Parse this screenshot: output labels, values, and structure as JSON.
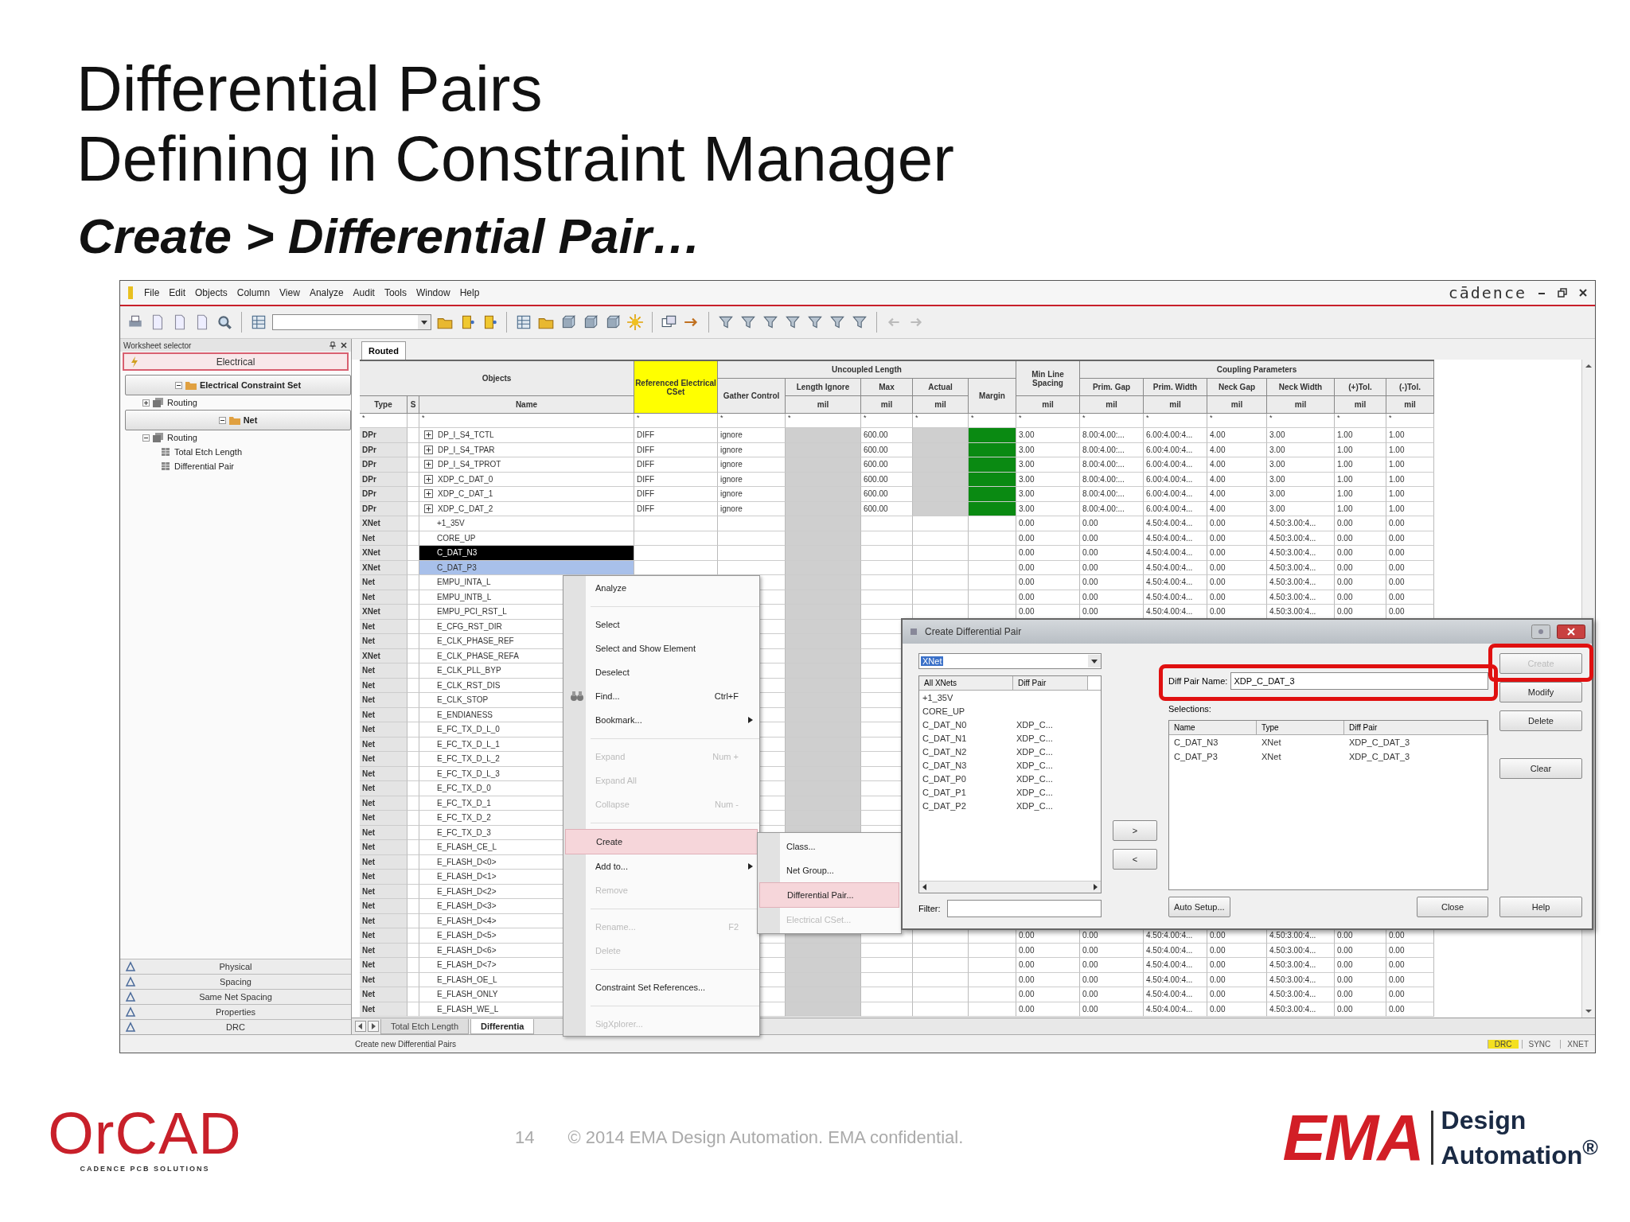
{
  "slide": {
    "title_lines": [
      "Differential Pairs",
      "Defining in Constraint Manager"
    ],
    "subtitle": "Create > Differential Pair…"
  },
  "app": {
    "menu": [
      "File",
      "Edit",
      "Objects",
      "Column",
      "View",
      "Analyze",
      "Audit",
      "Tools",
      "Window",
      "Help"
    ],
    "brand": "cādence",
    "worksheet_selector": {
      "title": "Worksheet selector",
      "top_tabs": [
        {
          "label": "Electrical",
          "selected": true
        }
      ],
      "tree": [
        {
          "label": "Electrical Constraint Set",
          "expanded": true,
          "children": [
            {
              "label": "Routing",
              "expanded": false
            }
          ]
        },
        {
          "label": "Net",
          "expanded": true,
          "children": [
            {
              "label": "Routing",
              "expanded": true,
              "children": [
                {
                  "label": "Total Etch Length"
                },
                {
                  "label": "Differential Pair"
                }
              ]
            }
          ]
        }
      ],
      "bottom_tabs": [
        {
          "label": "Physical",
          "selected": false
        },
        {
          "label": "Spacing",
          "selected": false
        },
        {
          "label": "Same Net Spacing",
          "selected": false
        },
        {
          "label": "Properties",
          "selected": false
        },
        {
          "label": "DRC",
          "selected": false
        }
      ]
    },
    "sheet_tab": "Routed",
    "table": {
      "header": {
        "objects": "Objects",
        "type": "Type",
        "s": "S",
        "name": "Name",
        "ref": "Referenced Electrical CSet",
        "ref_highlighted": true,
        "gather": "Gather Control",
        "uncoupled": "Uncoupled Length",
        "length_ignore": "Length Ignore",
        "max": "Max",
        "actual": "Actual",
        "margin": "Margin",
        "min_line": "Min Line Spacing",
        "coupling": "Coupling Parameters",
        "coupling_cols": [
          "Prim. Gap",
          "Prim. Width",
          "Neck Gap",
          "Neck Width",
          "(+)Tol.",
          "(-)Tol."
        ],
        "units": [
          "mil",
          "mil",
          "mil",
          "mil",
          "mil",
          "mil",
          "mil",
          "mil",
          "mil",
          "mil"
        ]
      },
      "filters": [
        "*",
        "*",
        "*",
        "*",
        "*",
        "*",
        "*",
        "*",
        "*",
        "*",
        "*",
        "*",
        "*",
        "*",
        "*"
      ],
      "rows": [
        {
          "type": "DPr",
          "name": "DP_I_S4_TCTL",
          "expanded": false,
          "selected": false,
          "ref": "DIFF",
          "gather": "ignore",
          "max": "600.00",
          "margin_ok": true,
          "spacing": [
            "3.00",
            "8.00:4.00:...",
            "6.00:4.00:4...",
            "4.00",
            "3.00",
            "1.00",
            "1.00"
          ]
        },
        {
          "type": "DPr",
          "name": "DP_I_S4_TPAR",
          "expanded": false,
          "selected": false,
          "ref": "DIFF",
          "gather": "ignore",
          "max": "600.00",
          "margin_ok": true,
          "spacing": [
            "3.00",
            "8.00:4.00:...",
            "6.00:4.00:4...",
            "4.00",
            "3.00",
            "1.00",
            "1.00"
          ]
        },
        {
          "type": "DPr",
          "name": "DP_I_S4_TPROT",
          "expanded": false,
          "selected": false,
          "ref": "DIFF",
          "gather": "ignore",
          "max": "600.00",
          "margin_ok": true,
          "spacing": [
            "3.00",
            "8.00:4.00:...",
            "6.00:4.00:4...",
            "4.00",
            "3.00",
            "1.00",
            "1.00"
          ]
        },
        {
          "type": "DPr",
          "name": "XDP_C_DAT_0",
          "expanded": false,
          "selected": false,
          "ref": "DIFF",
          "gather": "ignore",
          "max": "600.00",
          "margin_ok": true,
          "spacing": [
            "3.00",
            "8.00:4.00:...",
            "6.00:4.00:4...",
            "4.00",
            "3.00",
            "1.00",
            "1.00"
          ]
        },
        {
          "type": "DPr",
          "name": "XDP_C_DAT_1",
          "expanded": false,
          "selected": false,
          "ref": "DIFF",
          "gather": "ignore",
          "max": "600.00",
          "margin_ok": true,
          "spacing": [
            "3.00",
            "8.00:4.00:...",
            "6.00:4.00:4...",
            "4.00",
            "3.00",
            "1.00",
            "1.00"
          ]
        },
        {
          "type": "DPr",
          "name": "XDP_C_DAT_2",
          "expanded": false,
          "selected": false,
          "ref": "DIFF",
          "gather": "ignore",
          "max": "600.00",
          "margin_ok": true,
          "spacing": [
            "3.00",
            "8.00:4.00:...",
            "6.00:4.00:4...",
            "4.00",
            "3.00",
            "1.00",
            "1.00"
          ]
        },
        {
          "type": "XNet",
          "name": "+1_35V",
          "selected": false,
          "margin_ok": false,
          "spacing": [
            "0.00",
            "0.00",
            "4.50:4.00:4...",
            "0.00",
            "4.50:3.00:4...",
            "0.00",
            "0.00"
          ]
        },
        {
          "type": "Net",
          "name": "CORE_UP",
          "selected": false,
          "margin_ok": false,
          "spacing": [
            "0.00",
            "0.00",
            "4.50:4.00:4...",
            "0.00",
            "4.50:3.00:4...",
            "0.00",
            "0.00"
          ]
        },
        {
          "type": "XNet",
          "name": "C_DAT_N3",
          "selected": true,
          "current": true,
          "margin_ok": false,
          "spacing": [
            "0.00",
            "0.00",
            "4.50:4.00:4...",
            "0.00",
            "4.50:3.00:4...",
            "0.00",
            "0.00"
          ]
        },
        {
          "type": "XNet",
          "name": "C_DAT_P3",
          "selected": true,
          "current": false,
          "margin_ok": false,
          "spacing": [
            "0.00",
            "0.00",
            "4.50:4.00:4...",
            "0.00",
            "4.50:3.00:4...",
            "0.00",
            "0.00"
          ]
        },
        {
          "type": "Net",
          "name": "EMPU_INTA_L",
          "selected": false,
          "margin_ok": false,
          "spacing": [
            "0.00",
            "0.00",
            "4.50:4.00:4...",
            "0.00",
            "4.50:3.00:4...",
            "0.00",
            "0.00"
          ]
        },
        {
          "type": "Net",
          "name": "EMPU_INTB_L",
          "selected": false,
          "margin_ok": false,
          "spacing": [
            "0.00",
            "0.00",
            "4.50:4.00:4...",
            "0.00",
            "4.50:3.00:4...",
            "0.00",
            "0.00"
          ]
        },
        {
          "type": "XNet",
          "name": "EMPU_PCI_RST_L",
          "selected": false,
          "margin_ok": false,
          "spacing": [
            "0.00",
            "0.00",
            "4.50:4.00:4...",
            "0.00",
            "4.50:3.00:4...",
            "0.00",
            "0.00"
          ]
        },
        {
          "type": "Net",
          "name": "E_CFG_RST_DIR",
          "selected": false
        },
        {
          "type": "Net",
          "name": "E_CLK_PHASE_REF",
          "selected": false
        },
        {
          "type": "XNet",
          "name": "E_CLK_PHASE_REFA",
          "selected": false
        },
        {
          "type": "Net",
          "name": "E_CLK_PLL_BYP",
          "selected": false
        },
        {
          "type": "Net",
          "name": "E_CLK_RST_DIS",
          "selected": false
        },
        {
          "type": "Net",
          "name": "E_CLK_STOP",
          "selected": false
        },
        {
          "type": "Net",
          "name": "E_ENDIANESS",
          "selected": false
        },
        {
          "type": "Net",
          "name": "E_FC_TX_D_L_0",
          "selected": false
        },
        {
          "type": "Net",
          "name": "E_FC_TX_D_L_1",
          "selected": false
        },
        {
          "type": "Net",
          "name": "E_FC_TX_D_L_2",
          "selected": false
        },
        {
          "type": "Net",
          "name": "E_FC_TX_D_L_3",
          "selected": false
        },
        {
          "type": "Net",
          "name": "E_FC_TX_D_0",
          "selected": false
        },
        {
          "type": "Net",
          "name": "E_FC_TX_D_1",
          "selected": false
        },
        {
          "type": "Net",
          "name": "E_FC_TX_D_2",
          "selected": false
        },
        {
          "type": "Net",
          "name": "E_FC_TX_D_3",
          "selected": false
        },
        {
          "type": "Net",
          "name": "E_FLASH_CE_L",
          "selected": false
        },
        {
          "type": "Net",
          "name": "E_FLASH_D<0>",
          "selected": false
        },
        {
          "type": "Net",
          "name": "E_FLASH_D<1>",
          "selected": false
        },
        {
          "type": "Net",
          "name": "E_FLASH_D<2>",
          "selected": false
        },
        {
          "type": "Net",
          "name": "E_FLASH_D<3>",
          "selected": false
        },
        {
          "type": "Net",
          "name": "E_FLASH_D<4>",
          "selected": false
        },
        {
          "type": "Net",
          "name": "E_FLASH_D<5>",
          "selected": false,
          "margin_ok": false,
          "spacing": [
            "0.00",
            "0.00",
            "4.50:4.00:4...",
            "0.00",
            "4.50:3.00:4...",
            "0.00",
            "0.00"
          ]
        },
        {
          "type": "Net",
          "name": "E_FLASH_D<6>",
          "selected": false,
          "margin_ok": false,
          "spacing": [
            "0.00",
            "0.00",
            "4.50:4.00:4...",
            "0.00",
            "4.50:3.00:4...",
            "0.00",
            "0.00"
          ]
        },
        {
          "type": "Net",
          "name": "E_FLASH_D<7>",
          "selected": false,
          "margin_ok": false,
          "spacing": [
            "0.00",
            "0.00",
            "4.50:4.00:4...",
            "0.00",
            "4.50:3.00:4...",
            "0.00",
            "0.00"
          ]
        },
        {
          "type": "Net",
          "name": "E_FLASH_OE_L",
          "selected": false,
          "margin_ok": false,
          "spacing": [
            "0.00",
            "0.00",
            "4.50:4.00:4...",
            "0.00",
            "4.50:3.00:4...",
            "0.00",
            "0.00"
          ]
        },
        {
          "type": "Net",
          "name": "E_FLASH_ONLY",
          "selected": false,
          "margin_ok": false,
          "spacing": [
            "0.00",
            "0.00",
            "4.50:4.00:4...",
            "0.00",
            "4.50:3.00:4...",
            "0.00",
            "0.00"
          ]
        },
        {
          "type": "Net",
          "name": "E_FLASH_WE_L",
          "selected": false,
          "margin_ok": false,
          "spacing": [
            "0.00",
            "0.00",
            "4.50:4.00:4...",
            "0.00",
            "4.50:3.00:4...",
            "0.00",
            "0.00"
          ]
        }
      ]
    },
    "sheet_tabs": [
      {
        "label": "Total Etch Length",
        "selected": false
      },
      {
        "label": "Differentia",
        "selected": true
      }
    ],
    "context_menu": [
      {
        "kind": "item",
        "label": "Analyze",
        "disabled": false,
        "selected": false,
        "submenu": false
      },
      {
        "kind": "separator"
      },
      {
        "kind": "item",
        "label": "Select",
        "disabled": false,
        "selected": false,
        "submenu": false
      },
      {
        "kind": "item",
        "label": "Select and Show Element",
        "disabled": false,
        "selected": false,
        "submenu": false
      },
      {
        "kind": "item",
        "label": "Deselect",
        "disabled": false,
        "selected": false,
        "submenu": false
      },
      {
        "kind": "item",
        "label": "Find...",
        "shortcut": "Ctrl+F",
        "icon": true,
        "disabled": false,
        "selected": false,
        "submenu": false
      },
      {
        "kind": "item",
        "label": "Bookmark...",
        "disabled": false,
        "selected": false,
        "submenu": true
      },
      {
        "kind": "separator"
      },
      {
        "kind": "item",
        "label": "Expand",
        "shortcut": "Num +",
        "disabled": true,
        "selected": false,
        "submenu": false
      },
      {
        "kind": "item",
        "label": "Expand All",
        "disabled": true,
        "selected": false,
        "submenu": false
      },
      {
        "kind": "item",
        "label": "Collapse",
        "shortcut": "Num -",
        "disabled": true,
        "selected": false,
        "submenu": false
      },
      {
        "kind": "separator"
      },
      {
        "kind": "item",
        "label": "Create",
        "disabled": false,
        "selected": true,
        "submenu": false
      },
      {
        "kind": "item",
        "label": "Add to...",
        "disabled": false,
        "selected": false,
        "submenu": true
      },
      {
        "kind": "item",
        "label": "Remove",
        "disabled": true,
        "selected": false,
        "submenu": false
      },
      {
        "kind": "separator"
      },
      {
        "kind": "item",
        "label": "Rename...",
        "shortcut": "F2",
        "disabled": true,
        "selected": false,
        "submenu": false
      },
      {
        "kind": "item",
        "label": "Delete",
        "disabled": true,
        "selected": false,
        "submenu": false
      },
      {
        "kind": "separator"
      },
      {
        "kind": "item",
        "label": "Constraint Set References...",
        "disabled": false,
        "selected": false,
        "submenu": false
      },
      {
        "kind": "separator"
      },
      {
        "kind": "item",
        "label": "SigXplorer...",
        "disabled": true,
        "selected": false,
        "submenu": false
      }
    ],
    "submenu": [
      {
        "label": "Class...",
        "disabled": false,
        "selected": false
      },
      {
        "label": "Net Group...",
        "disabled": false,
        "selected": false
      },
      {
        "label": "Differential Pair...",
        "disabled": false,
        "selected": true
      },
      {
        "label": "Electrical CSet...",
        "disabled": true,
        "selected": false
      }
    ],
    "dialog": {
      "title": "Create Differential Pair",
      "filter_type": "XNet",
      "list_columns": [
        "All XNets",
        "Diff Pair"
      ],
      "list_rows": [
        {
          "name": "+1_35V"
        },
        {
          "name": "CORE_UP"
        },
        {
          "name": "C_DAT_N0",
          "pair": "XDP_C..."
        },
        {
          "name": "C_DAT_N1",
          "pair": "XDP_C..."
        },
        {
          "name": "C_DAT_N2",
          "pair": "XDP_C..."
        },
        {
          "name": "C_DAT_N3",
          "pair": "XDP_C..."
        },
        {
          "name": "C_DAT_P0",
          "pair": "XDP_C..."
        },
        {
          "name": "C_DAT_P1",
          "pair": "XDP_C..."
        },
        {
          "name": "C_DAT_P2",
          "pair": "XDP_C..."
        }
      ],
      "move_buttons": [
        ">",
        "<"
      ],
      "filter_label": "Filter:",
      "name_label": "Diff Pair Name:",
      "name_value": "XDP_C_DAT_3",
      "name_callout": true,
      "selections_label": "Selections:",
      "selection_columns": [
        "Name",
        "Type",
        "Diff Pair"
      ],
      "selections": [
        {
          "name": "C_DAT_N3",
          "type": "XNet",
          "pair": "XDP_C_DAT_3"
        },
        {
          "name": "C_DAT_P3",
          "type": "XNet",
          "pair": "XDP_C_DAT_3"
        }
      ],
      "side_buttons": [
        {
          "label": "Create",
          "disabled": true,
          "callout": true
        },
        {
          "label": "Modify",
          "disabled": false,
          "callout": false
        },
        {
          "label": "Delete",
          "disabled": false,
          "callout": false
        },
        {
          "label": "Clear",
          "disabled": false,
          "callout": false
        }
      ],
      "auto_setup": "Auto Setup...",
      "close": "Close",
      "help": "Help"
    },
    "status": {
      "message": "Create new Differential Pairs",
      "indicators": [
        {
          "label": "DRC",
          "on": true
        },
        {
          "label": "SYNC",
          "on": false
        },
        {
          "label": "XNET",
          "on": false
        }
      ]
    }
  },
  "footer": {
    "orcad": "OrCAD",
    "orcad_tagline": "CADENCE PCB SOLUTIONS",
    "page": "14",
    "copyright": "© 2014 EMA Design Automation. EMA confidential.",
    "ema": "EMA",
    "ema_lines": [
      "Design",
      "Automation$^{®}$"
    ]
  }
}
